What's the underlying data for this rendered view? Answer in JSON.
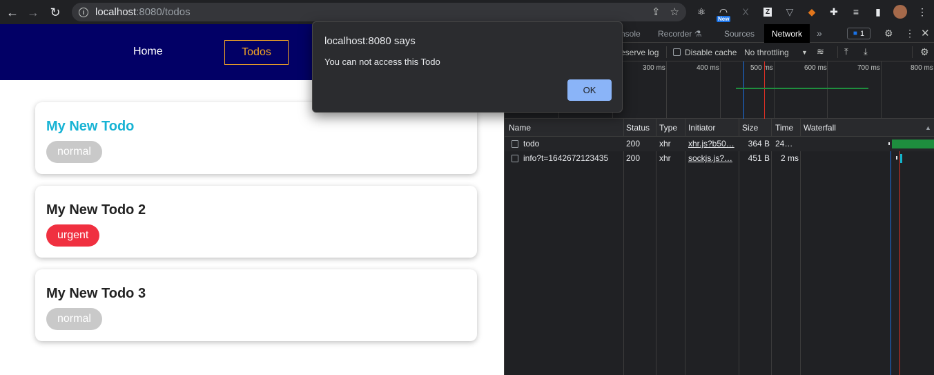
{
  "browser": {
    "url_host": "localhost",
    "url_rest": ":8080/todos",
    "ext_new_badge": "New"
  },
  "nav": {
    "home": "Home",
    "todos": "Todos"
  },
  "todos": [
    {
      "title": "My New Todo",
      "priority": "normal"
    },
    {
      "title": "My New Todo 2",
      "priority": "urgent"
    },
    {
      "title": "My New Todo 3",
      "priority": "normal"
    }
  ],
  "dialog": {
    "title": "localhost:8080 says",
    "message": "You can not access this Todo",
    "ok": "OK"
  },
  "devtools": {
    "tabs": [
      "nsole",
      "Recorder",
      "Sources",
      "Network"
    ],
    "issues_count": "1",
    "toolbar": {
      "preserve_log": "eserve log",
      "disable_cache": "Disable cache",
      "throttling": "No throttling"
    },
    "timeline_ticks": [
      "300 ms",
      "400 ms",
      "500 ms",
      "600 ms",
      "700 ms",
      "800 ms"
    ],
    "columns": [
      "Name",
      "Status",
      "Type",
      "Initiator",
      "Size",
      "Time",
      "Waterfall"
    ],
    "rows": [
      {
        "name": "todo",
        "status": "200",
        "type": "xhr",
        "initiator": "xhr.js?b50…",
        "size": "364 B",
        "time": "24…"
      },
      {
        "name": "info?t=1642672123435",
        "status": "200",
        "type": "xhr",
        "initiator": "sockjs.js?…",
        "size": "451 B",
        "time": "2 ms"
      }
    ]
  },
  "colors": {
    "navbar": "#020066",
    "active_accent": "#f5a623",
    "title_active": "#17b3d4",
    "urgent": "#f03040",
    "normal": "#c9c9c9"
  }
}
